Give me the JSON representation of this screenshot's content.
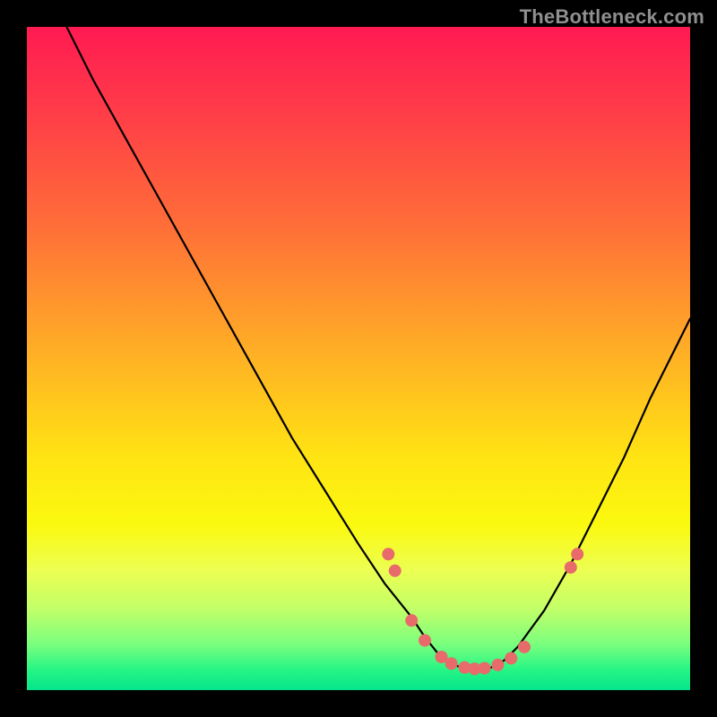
{
  "watermark": "TheBottleneck.com",
  "chart_data": {
    "type": "line",
    "title": "",
    "xlabel": "",
    "ylabel": "",
    "xlim": [
      0,
      100
    ],
    "ylim": [
      0,
      100
    ],
    "note": "Axes unlabeled in source image; x and y expressed as 0-100 percent of plot area (x left→right, y bottom→top). Curve is a V-shaped line with a flattened minimum around x≈62-72. Markers are salmon-colored points near the valley.",
    "series": [
      {
        "name": "curve",
        "color": "#000000",
        "x": [
          6,
          10,
          15,
          20,
          25,
          30,
          35,
          40,
          45,
          50,
          54,
          58,
          60,
          62,
          64,
          66,
          68,
          70,
          72,
          74,
          78,
          82,
          86,
          90,
          94,
          98,
          100
        ],
        "y": [
          100,
          92,
          83,
          74,
          65,
          56,
          47,
          38,
          30,
          22,
          16,
          11,
          8,
          5.5,
          4,
          3.2,
          3,
          3.4,
          4.5,
          6.5,
          12,
          19,
          27,
          35,
          44,
          52,
          56
        ]
      }
    ],
    "markers": {
      "name": "data-points",
      "shape": "circle",
      "color": "#e86a6a",
      "radius_px": 7,
      "points": [
        {
          "x": 54.5,
          "y": 20.5
        },
        {
          "x": 55.5,
          "y": 18.0
        },
        {
          "x": 58.0,
          "y": 10.5
        },
        {
          "x": 60.0,
          "y": 7.5
        },
        {
          "x": 62.5,
          "y": 5.0
        },
        {
          "x": 64.0,
          "y": 4.0
        },
        {
          "x": 66.0,
          "y": 3.4
        },
        {
          "x": 67.5,
          "y": 3.2
        },
        {
          "x": 69.0,
          "y": 3.3
        },
        {
          "x": 71.0,
          "y": 3.8
        },
        {
          "x": 73.0,
          "y": 4.8
        },
        {
          "x": 75.0,
          "y": 6.5
        },
        {
          "x": 82.0,
          "y": 18.5
        },
        {
          "x": 83.0,
          "y": 20.5
        }
      ]
    },
    "background_gradient": {
      "direction": "top-to-bottom",
      "stops": [
        {
          "pos": 0.0,
          "color": "#ff1a52"
        },
        {
          "pos": 0.5,
          "color": "#ffb224"
        },
        {
          "pos": 0.75,
          "color": "#fbf90f"
        },
        {
          "pos": 1.0,
          "color": "#06e58b"
        }
      ]
    }
  }
}
